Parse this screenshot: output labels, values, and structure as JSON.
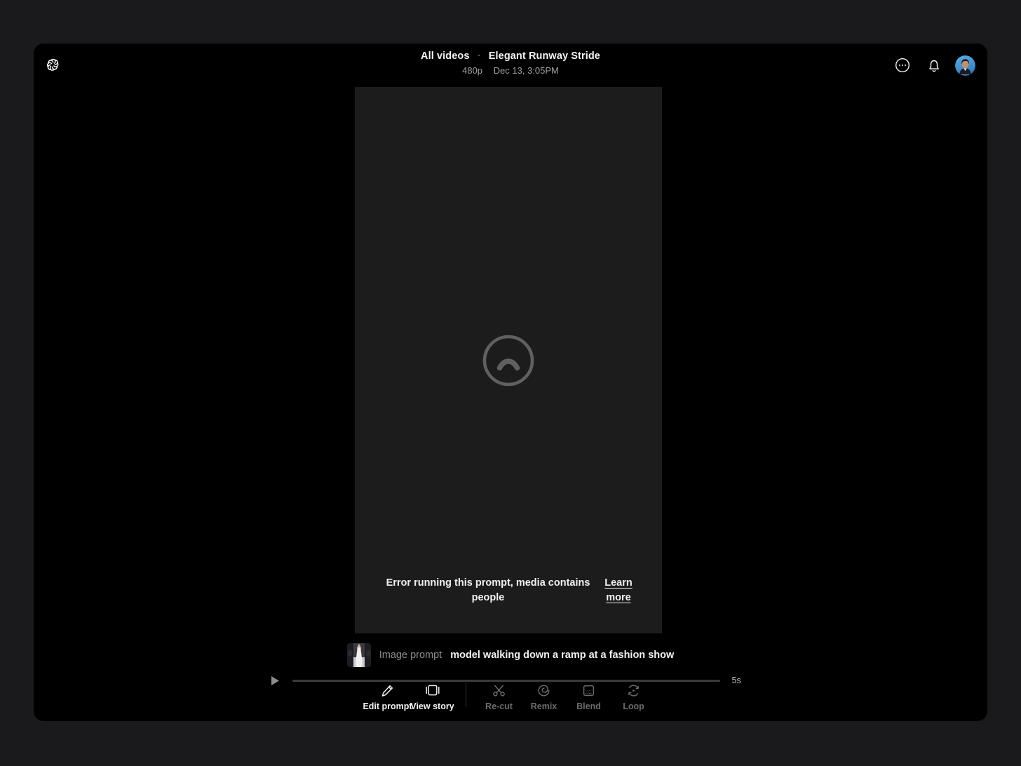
{
  "theme": {
    "page_bg": "#1a1a1c",
    "window_bg": "#000000",
    "canvas_bg": "#1c1c1c",
    "text_primary": "#f2f2f2",
    "text_muted": "#8e8e8e",
    "text_disabled": "#6d6d6d",
    "avatar_bg": "#3a93d6"
  },
  "header": {
    "logo_icon": "openai-logo-icon",
    "breadcrumb_root": "All videos",
    "breadcrumb_separator": "·",
    "breadcrumb_current": "Elegant Runway Stride",
    "resolution": "480p",
    "timestamp": "Dec 13, 3:05PM",
    "actions": [
      {
        "name": "more-options-button",
        "icon": "ellipsis-circle-icon"
      },
      {
        "name": "notifications-button",
        "icon": "bell-icon"
      },
      {
        "name": "avatar",
        "icon": "user-avatar-photo"
      }
    ]
  },
  "canvas": {
    "state_icon": "sad-face-icon",
    "error_message": "Error running this prompt, media contains people",
    "error_link_label": "Learn more"
  },
  "prompt": {
    "thumbnail_icon": "image-prompt-thumbnail",
    "label": "Image prompt",
    "text": "model walking down a ramp at a fashion show"
  },
  "timeline": {
    "play_icon": "play-icon",
    "progress_percent": 0,
    "duration": "5s"
  },
  "toolbar": {
    "items": [
      {
        "label": "Edit prompt",
        "icon": "pencil-icon",
        "name": "edit-prompt-button",
        "disabled": false
      },
      {
        "label": "View story",
        "icon": "storyboard-icon",
        "name": "view-story-button",
        "disabled": false
      },
      {
        "label": "Re-cut",
        "icon": "scissors-icon",
        "name": "re-cut-button",
        "disabled": true
      },
      {
        "label": "Remix",
        "icon": "remix-spiral-icon",
        "name": "remix-button",
        "disabled": true
      },
      {
        "label": "Blend",
        "icon": "blend-icon",
        "name": "blend-button",
        "disabled": true
      },
      {
        "label": "Loop",
        "icon": "loop-icon",
        "name": "loop-button",
        "disabled": true
      }
    ]
  }
}
